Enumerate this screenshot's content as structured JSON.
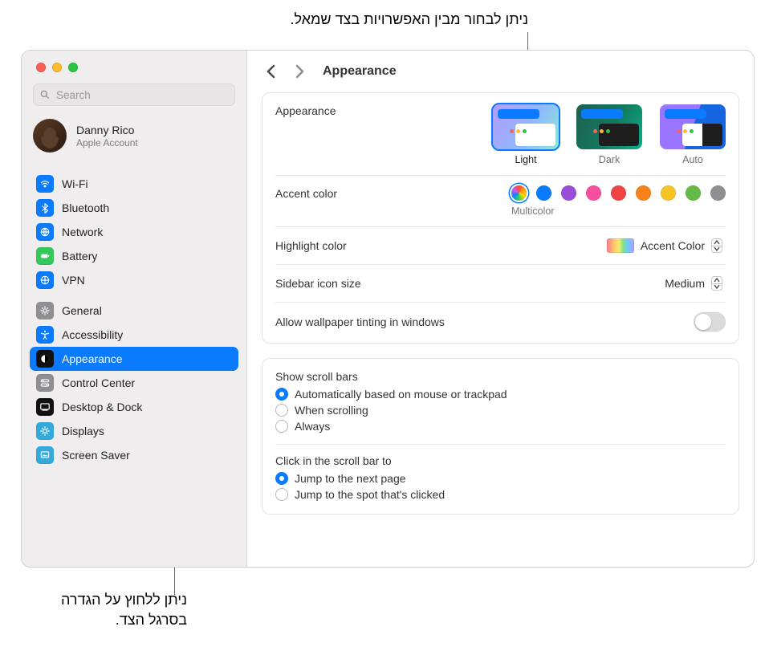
{
  "callouts": {
    "top": "ניתן לבחור מבין האפשרויות בצד שמאל.",
    "bottom_line1": "ניתן ללחוץ על הגדרה",
    "bottom_line2": "בסרגל הצד."
  },
  "search": {
    "placeholder": "Search"
  },
  "account": {
    "name": "Danny Rico",
    "sub": "Apple Account"
  },
  "header": {
    "title": "Appearance"
  },
  "sidebar": {
    "group1": [
      {
        "key": "wifi",
        "label": "Wi-Fi",
        "color": "#0a7aff"
      },
      {
        "key": "bluetooth",
        "label": "Bluetooth",
        "color": "#0a7aff"
      },
      {
        "key": "network",
        "label": "Network",
        "color": "#0a7aff"
      },
      {
        "key": "battery",
        "label": "Battery",
        "color": "#34c759"
      },
      {
        "key": "vpn",
        "label": "VPN",
        "color": "#0a7aff"
      }
    ],
    "group2": [
      {
        "key": "general",
        "label": "General",
        "color": "#8e8e93"
      },
      {
        "key": "accessibility",
        "label": "Accessibility",
        "color": "#0a7aff"
      },
      {
        "key": "appearance",
        "label": "Appearance",
        "color": "#111111",
        "selected": true
      },
      {
        "key": "controlcenter",
        "label": "Control Center",
        "color": "#8e8e93"
      },
      {
        "key": "dock",
        "label": "Desktop & Dock",
        "color": "#111111"
      },
      {
        "key": "displays",
        "label": "Displays",
        "color": "#34aadc"
      },
      {
        "key": "screensaver",
        "label": "Screen Saver",
        "color": "#34aadc"
      }
    ]
  },
  "appearance": {
    "label": "Appearance",
    "options": [
      {
        "key": "light",
        "label": "Light",
        "selected": true
      },
      {
        "key": "dark",
        "label": "Dark"
      },
      {
        "key": "auto",
        "label": "Auto"
      }
    ]
  },
  "accent": {
    "label": "Accent color",
    "sublabel": "Multicolor",
    "colors": [
      {
        "key": "multicolor",
        "css": "conic-gradient(#ff453a,#ff9f0a,#ffd60a,#32d74b,#0a84ff,#bf5af2,#ff453a)",
        "selected": true
      },
      {
        "key": "blue",
        "css": "#0a7aff"
      },
      {
        "key": "purple",
        "css": "#9a4ed8"
      },
      {
        "key": "pink",
        "css": "#f74f9e"
      },
      {
        "key": "red",
        "css": "#ef4444"
      },
      {
        "key": "orange",
        "css": "#f7821b"
      },
      {
        "key": "yellow",
        "css": "#f7c325"
      },
      {
        "key": "green",
        "css": "#63ba47"
      },
      {
        "key": "graphite",
        "css": "#8e8e93"
      }
    ]
  },
  "rows": {
    "highlight_label": "Highlight color",
    "highlight_value": "Accent Color",
    "iconsize_label": "Sidebar icon size",
    "iconsize_value": "Medium",
    "tinting_label": "Allow wallpaper tinting in windows"
  },
  "scrollbars": {
    "heading": "Show scroll bars",
    "options": [
      {
        "label": "Automatically based on mouse or trackpad",
        "on": true
      },
      {
        "label": "When scrolling"
      },
      {
        "label": "Always"
      }
    ]
  },
  "scrollclick": {
    "heading": "Click in the scroll bar to",
    "options": [
      {
        "label": "Jump to the next page",
        "on": true
      },
      {
        "label": "Jump to the spot that's clicked"
      }
    ]
  }
}
